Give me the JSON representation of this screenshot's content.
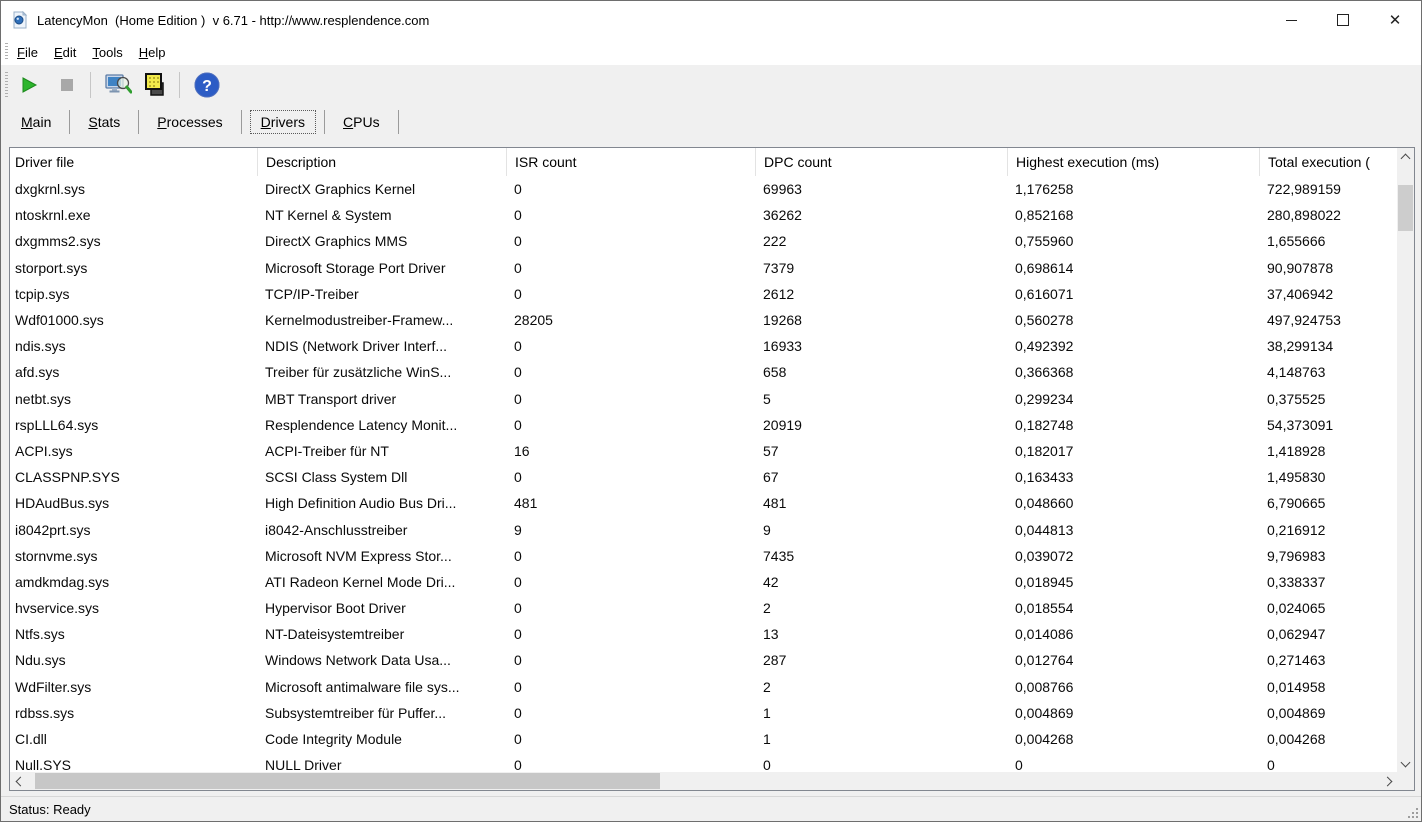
{
  "window": {
    "title": "LatencyMon  (Home Edition )  v 6.71 - http://www.resplendence.com",
    "status": "Status: Ready"
  },
  "menu": {
    "items": [
      "File",
      "Edit",
      "Tools",
      "Help"
    ]
  },
  "toolbar": {
    "icons": [
      "start-monitor-icon",
      "stop-monitor-icon",
      "report-icon",
      "processes-memory-icon",
      "help-icon"
    ]
  },
  "tabs": [
    {
      "label": "Main",
      "selected": false
    },
    {
      "label": "Stats",
      "selected": false
    },
    {
      "label": "Processes",
      "selected": false
    },
    {
      "label": "Drivers",
      "selected": true
    },
    {
      "label": "CPUs",
      "selected": false
    }
  ],
  "table": {
    "columns": [
      "Driver file",
      "Description",
      "ISR count",
      "DPC count",
      "Highest execution (ms)",
      "Total execution ("
    ],
    "rows": [
      [
        "dxgkrnl.sys",
        "DirectX Graphics Kernel",
        "0",
        "69963",
        "1,176258",
        "722,989159"
      ],
      [
        "ntoskrnl.exe",
        "NT Kernel & System",
        "0",
        "36262",
        "0,852168",
        "280,898022"
      ],
      [
        "dxgmms2.sys",
        "DirectX Graphics MMS",
        "0",
        "222",
        "0,755960",
        "1,655666"
      ],
      [
        "storport.sys",
        "Microsoft Storage Port Driver",
        "0",
        "7379",
        "0,698614",
        "90,907878"
      ],
      [
        "tcpip.sys",
        "TCP/IP-Treiber",
        "0",
        "2612",
        "0,616071",
        "37,406942"
      ],
      [
        "Wdf01000.sys",
        "Kernelmodustreiber-Framew...",
        "28205",
        "19268",
        "0,560278",
        "497,924753"
      ],
      [
        "ndis.sys",
        "NDIS (Network Driver Interf...",
        "0",
        "16933",
        "0,492392",
        "38,299134"
      ],
      [
        "afd.sys",
        "Treiber für zusätzliche WinS...",
        "0",
        "658",
        "0,366368",
        "4,148763"
      ],
      [
        "netbt.sys",
        "MBT Transport driver",
        "0",
        "5",
        "0,299234",
        "0,375525"
      ],
      [
        "rspLLL64.sys",
        "Resplendence Latency Monit...",
        "0",
        "20919",
        "0,182748",
        "54,373091"
      ],
      [
        "ACPI.sys",
        "ACPI-Treiber für NT",
        "16",
        "57",
        "0,182017",
        "1,418928"
      ],
      [
        "CLASSPNP.SYS",
        "SCSI Class System Dll",
        "0",
        "67",
        "0,163433",
        "1,495830"
      ],
      [
        "HDAudBus.sys",
        "High Definition Audio Bus Dri...",
        "481",
        "481",
        "0,048660",
        "6,790665"
      ],
      [
        "i8042prt.sys",
        "i8042-Anschlusstreiber",
        "9",
        "9",
        "0,044813",
        "0,216912"
      ],
      [
        "stornvme.sys",
        "Microsoft NVM Express Stor...",
        "0",
        "7435",
        "0,039072",
        "9,796983"
      ],
      [
        "amdkmdag.sys",
        "ATI Radeon Kernel Mode Dri...",
        "0",
        "42",
        "0,018945",
        "0,338337"
      ],
      [
        "hvservice.sys",
        "Hypervisor Boot Driver",
        "0",
        "2",
        "0,018554",
        "0,024065"
      ],
      [
        "Ntfs.sys",
        "NT-Dateisystemtreiber",
        "0",
        "13",
        "0,014086",
        "0,062947"
      ],
      [
        "Ndu.sys",
        "Windows Network Data Usa...",
        "0",
        "287",
        "0,012764",
        "0,271463"
      ],
      [
        "WdFilter.sys",
        "Microsoft antimalware file sys...",
        "0",
        "2",
        "0,008766",
        "0,014958"
      ],
      [
        "rdbss.sys",
        "Subsystemtreiber für Puffer...",
        "0",
        "1",
        "0,004869",
        "0,004869"
      ],
      [
        "CI.dll",
        "Code Integrity Module",
        "0",
        "1",
        "0,004268",
        "0,004268"
      ],
      [
        "Null.SYS",
        "NULL Driver",
        "0",
        "0",
        "0",
        "0"
      ]
    ]
  },
  "colors": {
    "start_green": "#2db52d",
    "stop_gray": "#a8a8a8",
    "help_blue": "#2c5cc5",
    "icon_yellow": "#f2ea4b",
    "toolbar_bg": "#f0f0f0",
    "scrollbar_thumb": "#cdcdcd"
  }
}
